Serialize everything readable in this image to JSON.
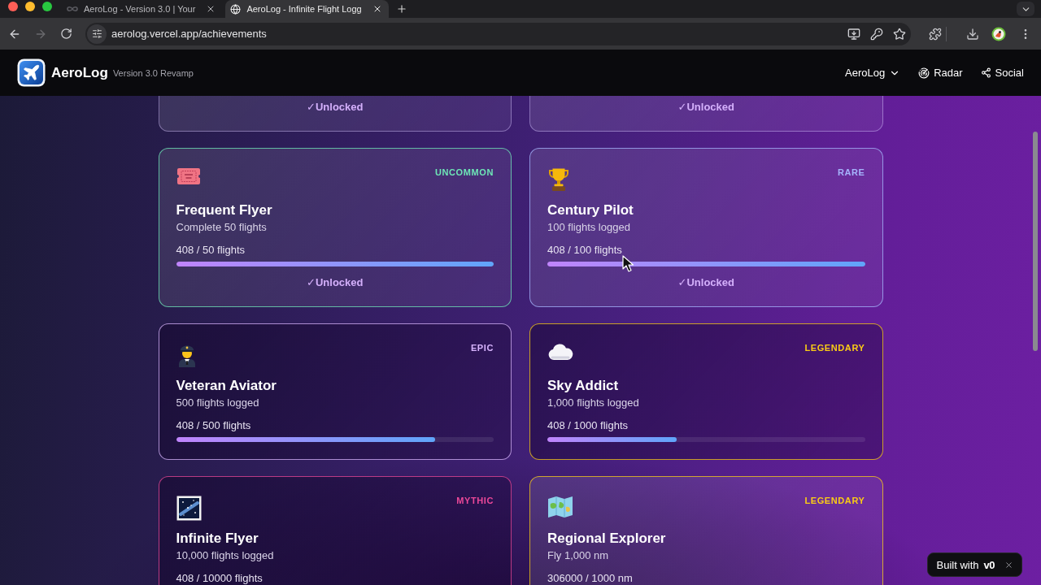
{
  "browser": {
    "tabs": [
      {
        "title": "AeroLog - Version 3.0 | Your",
        "selected": false
      },
      {
        "title": "AeroLog - Infinite Flight Logg",
        "selected": true
      }
    ],
    "nav_buttons": [
      {
        "kind": "back",
        "disabled": false
      },
      {
        "kind": "forward",
        "disabled": true
      },
      {
        "kind": "reload",
        "disabled": false
      }
    ],
    "url": "aerolog.vercel.app/achievements"
  },
  "header": {
    "app_name": "AeroLog",
    "version": "Version 3.0 Revamp",
    "nav": [
      {
        "label": "AeroLog",
        "kind": "dropdown"
      },
      {
        "label": "Radar",
        "kind": "radar"
      },
      {
        "label": "Social",
        "kind": "share"
      }
    ]
  },
  "cards": [
    {
      "unlocked": true,
      "status": "✓Unlocked"
    },
    {
      "unlocked": true,
      "status": "✓Unlocked"
    },
    {
      "title": "Frequent Flyer",
      "description": "Complete 50 flights",
      "rarity": {
        "label": "UNCOMMON",
        "color": "#6ee7b7"
      },
      "progress": {
        "text": "408 / 50 flights",
        "level": 1
      },
      "unlocked": true,
      "status": "✓Unlocked"
    },
    {
      "title": "Century Pilot",
      "description": "100 flights logged",
      "rarity": {
        "label": "RARE",
        "color": "#a5b4fc"
      },
      "progress": {
        "text": "408 / 100 flights",
        "level": 1
      },
      "unlocked": true,
      "status": "✓Unlocked"
    },
    {
      "title": "Veteran Aviator",
      "description": "500 flights logged",
      "rarity": {
        "label": "EPIC",
        "color": "#d8b4fe"
      },
      "progress": {
        "text": "408 / 500 flights",
        "level": 0.816
      },
      "unlocked": false
    },
    {
      "title": "Sky Addict",
      "description": "1,000 flights logged",
      "rarity": {
        "label": "LEGENDARY",
        "color": "#facc15"
      },
      "progress": {
        "text": "408 / 1000 flights",
        "level": 0.408
      },
      "unlocked": false
    },
    {
      "title": "Infinite Flyer",
      "description": "10,000 flights logged",
      "rarity": {
        "label": "MYTHIC",
        "color": "#ec4899"
      },
      "progress": {
        "text": "408 / 10000 flights"
      },
      "unlocked": false
    },
    {
      "title": "Regional Explorer",
      "description": "Fly 1,000 nm",
      "rarity": {
        "label": "LEGENDARY",
        "color": "#facc15"
      },
      "progress": {
        "text": "306000 / 1000 nm"
      },
      "unlocked": true
    }
  ],
  "badge": {
    "label": "Built with",
    "logo": "v0"
  }
}
